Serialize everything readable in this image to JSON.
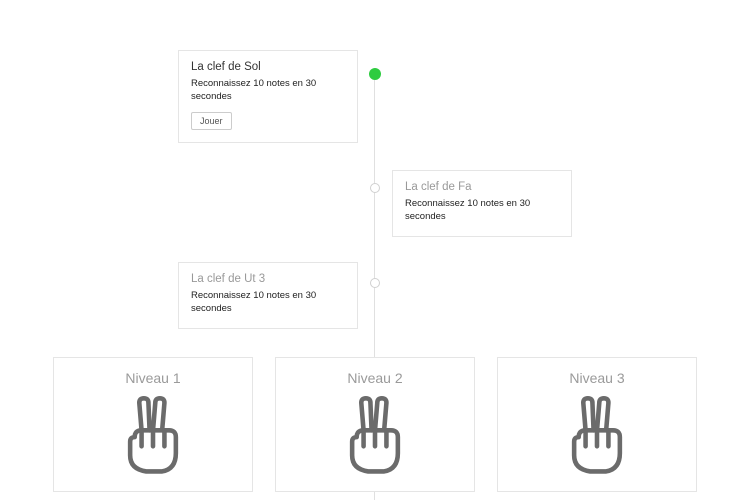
{
  "timeline": {
    "items": [
      {
        "title": "La clef de Sol",
        "desc": "Reconnaissez 10 notes en 30 secondes",
        "play_label": "Jouer",
        "active": true,
        "side": "left"
      },
      {
        "title": "La clef de Fa",
        "desc": "Reconnaissez 10 notes en 30 secondes",
        "active": false,
        "side": "right"
      },
      {
        "title": "La clef de Ut 3",
        "desc": "Reconnaissez 10 notes en 30 secondes",
        "active": false,
        "side": "left"
      }
    ]
  },
  "levels": [
    {
      "title": "Niveau 1"
    },
    {
      "title": "Niveau 2"
    },
    {
      "title": "Niveau 3"
    }
  ],
  "colors": {
    "accent": "#2ecc40"
  }
}
